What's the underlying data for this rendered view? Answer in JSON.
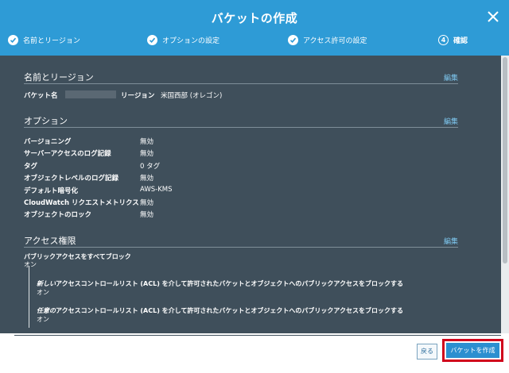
{
  "dialog": {
    "title": "バケットの作成"
  },
  "icons": {
    "close": "close-icon",
    "check": "checkmark-icon"
  },
  "steps": [
    {
      "label": "名前とリージョン",
      "state": "done"
    },
    {
      "label": "オプションの設定",
      "state": "done"
    },
    {
      "label": "アクセス許可の設定",
      "state": "done"
    },
    {
      "number": "4",
      "label": "確認",
      "state": "active"
    }
  ],
  "sections": {
    "name_region": {
      "title": "名前とリージョン",
      "edit": "編集",
      "bucket_label": "バケット名",
      "region_label": "リージョン",
      "region_value": "米国西部 (オレゴン)"
    },
    "options": {
      "title": "オプション",
      "edit": "編集",
      "items": [
        {
          "label": "バージョニング",
          "value": "無効"
        },
        {
          "label": "サーバーアクセスのログ記録",
          "value": "無効"
        },
        {
          "label": "タグ",
          "value": "0 タグ"
        },
        {
          "label": "オブジェクトレベルのログ記録",
          "value": "無効"
        },
        {
          "label": "デフォルト暗号化",
          "value": "AWS-KMS"
        },
        {
          "label": "CloudWatch リクエストメトリクス",
          "value": "無効"
        },
        {
          "label": "オブジェクトのロック",
          "value": "無効"
        }
      ]
    },
    "permissions": {
      "title": "アクセス権限",
      "edit": "編集",
      "block_all_label": "パブリックアクセスをすべてブロック",
      "block_all_value": "オン",
      "sub_items": [
        {
          "emphasis": "新しい",
          "rest": "アクセスコントロールリスト (ACL) を介して許可されたバケットとオブジェクトへのパブリックアクセスをブロックする",
          "value": "オン"
        },
        {
          "emphasis": "任意の",
          "rest": "アクセスコントロールリスト (ACL) を介して許可されたバケットとオブジェクトへのパブリックアクセスをブロックする",
          "value": "オン"
        }
      ]
    }
  },
  "footer": {
    "back": "戻る",
    "create": "バケットを作成"
  },
  "colors": {
    "header": "#2e9bd6",
    "content_bg": "#3f4f5b",
    "link": "#7ec8f0",
    "primary_button": "#2b8fd0",
    "highlight": "#d0021b"
  }
}
